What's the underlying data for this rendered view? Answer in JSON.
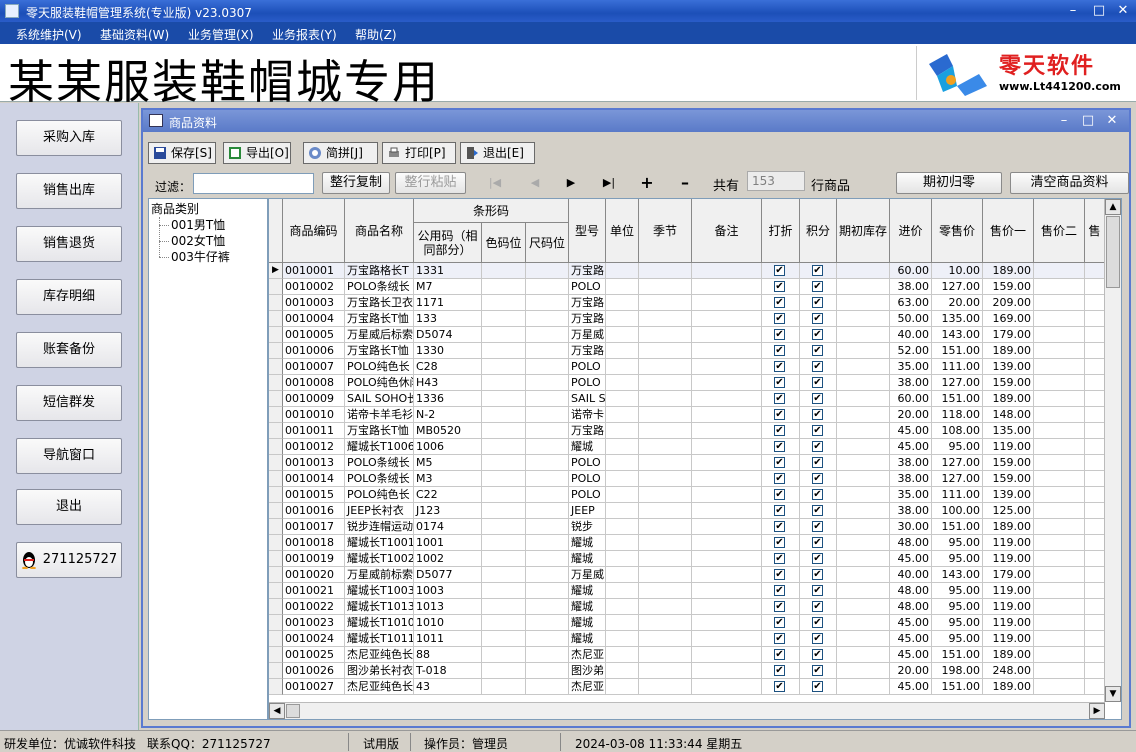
{
  "window": {
    "title": "零天服装鞋帽管理系统(专业版)  v23.0307"
  },
  "menu": [
    "系统维护(V)",
    "基础资料(W)",
    "业务管理(X)",
    "业务报表(Y)",
    "帮助(Z)"
  ],
  "banner": {
    "text": "某某服装鞋帽城专用",
    "logo_cn": "零天软件",
    "logo_url": "www.Lt441200.com"
  },
  "nav": [
    "采购入库",
    "销售出库",
    "销售退货",
    "库存明细",
    "账套备份",
    "短信群发",
    "导航窗口",
    "退出"
  ],
  "nav_qq": "271125727",
  "inner": {
    "title": "商品资料",
    "toolbar": [
      "保存[S]",
      "导出[O]",
      "简拼[J]",
      "打印[P]",
      "退出[E]"
    ],
    "filter_label": "过滤：",
    "filter_value": "",
    "copy_btn": "整行复制",
    "paste_btn": "整行粘贴",
    "count_prefix": "共有",
    "count": "153",
    "count_suffix": "行商品",
    "reset_btn": "期初归零",
    "clear_btn": "清空商品资料"
  },
  "tree": {
    "root": "商品类别",
    "children": [
      "001男T恤",
      "002女T恤",
      "003牛仔裤"
    ]
  },
  "grid": {
    "headers": {
      "code": "商品编码",
      "name": "商品名称",
      "barcode": "条形码",
      "barcode_common": "公用码（相同部分）",
      "color_pos": "色码位",
      "size_pos": "尺码位",
      "model": "型号",
      "unit": "单位",
      "season": "季节",
      "remark": "备注",
      "discount": "打折",
      "points": "积分",
      "opening": "期初库存",
      "cost": "进价",
      "retail": "零售价",
      "price1": "售价一",
      "price2": "售价二",
      "price3": "售"
    },
    "rows": [
      [
        "0010001",
        "万宝路格长T",
        "1331",
        "万宝路",
        "60.00",
        "10.00",
        "189.00"
      ],
      [
        "0010002",
        "POLO条绒长",
        "M7",
        "POLO",
        "38.00",
        "127.00",
        "159.00"
      ],
      [
        "0010003",
        "万宝路长卫衣",
        "1171",
        "万宝路",
        "63.00",
        "20.00",
        "209.00"
      ],
      [
        "0010004",
        "万宝路长T恤",
        "133",
        "万宝路",
        "50.00",
        "135.00",
        "169.00"
      ],
      [
        "0010005",
        "万星威后标索",
        "D5074",
        "万星威",
        "40.00",
        "143.00",
        "179.00"
      ],
      [
        "0010006",
        "万宝路长T恤",
        "1330",
        "万宝路",
        "52.00",
        "151.00",
        "189.00"
      ],
      [
        "0010007",
        "POLO纯色长",
        "C28",
        "POLO",
        "35.00",
        "111.00",
        "139.00"
      ],
      [
        "0010008",
        "POLO纯色休闲",
        "H43",
        "POLO",
        "38.00",
        "127.00",
        "159.00"
      ],
      [
        "0010009",
        "SAIL SOHO长",
        "1336",
        "SAIL S",
        "60.00",
        "151.00",
        "189.00"
      ],
      [
        "0010010",
        "诺帝卡羊毛衫",
        "N-2",
        "诺帝卡",
        "20.00",
        "118.00",
        "148.00"
      ],
      [
        "0010011",
        "万宝路长T恤",
        "MB0520",
        "万宝路",
        "45.00",
        "108.00",
        "135.00"
      ],
      [
        "0010012",
        "耀城长T1006",
        "1006",
        "耀城",
        "45.00",
        "95.00",
        "119.00"
      ],
      [
        "0010013",
        "POLO条绒长",
        "M5",
        "POLO",
        "38.00",
        "127.00",
        "159.00"
      ],
      [
        "0010014",
        "POLO条绒长",
        "M3",
        "POLO",
        "38.00",
        "127.00",
        "159.00"
      ],
      [
        "0010015",
        "POLO纯色长",
        "C22",
        "POLO",
        "35.00",
        "111.00",
        "139.00"
      ],
      [
        "0010016",
        "JEEP长衬衣",
        "J123",
        "JEEP",
        "38.00",
        "100.00",
        "125.00"
      ],
      [
        "0010017",
        "锐步连帽运动",
        "0174",
        "锐步",
        "30.00",
        "151.00",
        "189.00"
      ],
      [
        "0010018",
        "耀城长T1001",
        "1001",
        "耀城",
        "48.00",
        "95.00",
        "119.00"
      ],
      [
        "0010019",
        "耀城长T1002",
        "1002",
        "耀城",
        "45.00",
        "95.00",
        "119.00"
      ],
      [
        "0010020",
        "万星威前标索",
        "D5077",
        "万星威",
        "40.00",
        "143.00",
        "179.00"
      ],
      [
        "0010021",
        "耀城长T1003",
        "1003",
        "耀城",
        "48.00",
        "95.00",
        "119.00"
      ],
      [
        "0010022",
        "耀城长T1013",
        "1013",
        "耀城",
        "48.00",
        "95.00",
        "119.00"
      ],
      [
        "0010023",
        "耀城长T1010",
        "1010",
        "耀城",
        "45.00",
        "95.00",
        "119.00"
      ],
      [
        "0010024",
        "耀城长T1011",
        "1011",
        "耀城",
        "45.00",
        "95.00",
        "119.00"
      ],
      [
        "0010025",
        "杰尼亚纯色长",
        "88",
        "杰尼亚",
        "45.00",
        "151.00",
        "189.00"
      ],
      [
        "0010026",
        "图沙弟长衬衣",
        "T-018",
        "图沙弟",
        "20.00",
        "198.00",
        "248.00"
      ],
      [
        "0010027",
        "杰尼亚纯色长",
        "43",
        "杰尼亚",
        "45.00",
        "151.00",
        "189.00"
      ]
    ]
  },
  "status": {
    "dev": "研发单位：优诚软件科技",
    "qq": "联系QQ：271125727",
    "edition": "试用版",
    "operator": "操作员：管理员",
    "datetime": "2024-03-08 11:33:44 星期五"
  }
}
